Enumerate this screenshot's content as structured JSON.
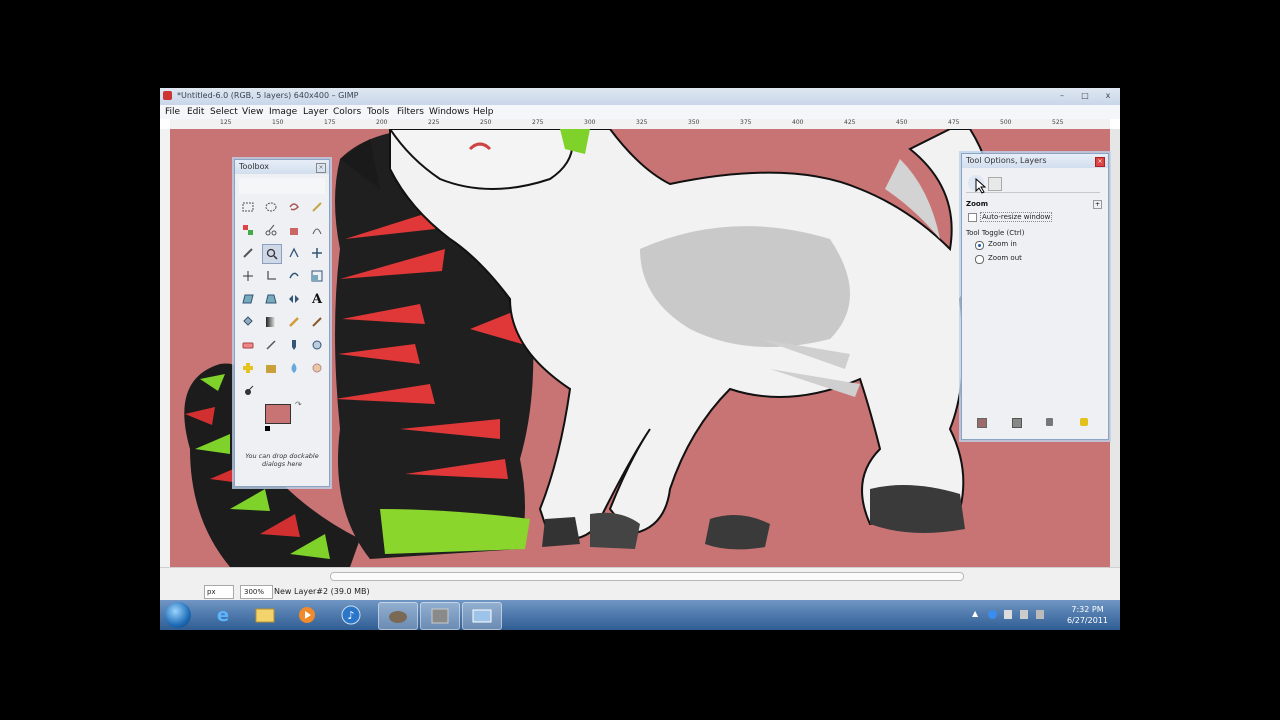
{
  "window": {
    "title": "*Untitled-6.0 (RGB, 5 layers) 640x400 – GIMP",
    "minimize": "–",
    "maximize": "□",
    "close": "x"
  },
  "menu": [
    "File",
    "Edit",
    "Select",
    "View",
    "Image",
    "Layer",
    "Colors",
    "Tools",
    "Filters",
    "Windows",
    "Help"
  ],
  "ruler_ticks": [
    "125",
    "150",
    "175",
    "200",
    "225",
    "250",
    "275",
    "300",
    "325",
    "350",
    "375",
    "400",
    "425",
    "450",
    "475",
    "500",
    "525"
  ],
  "toolbox": {
    "title": "Toolbox",
    "hint": "You can drop dockable dialogs here",
    "fg_color": "#c97474",
    "bg_color": "#ffffff"
  },
  "tool_options": {
    "title": "Tool Options, Layers",
    "section": "Zoom",
    "auto_resize_label": "Auto-resize window",
    "toggle_label": "Tool Toggle  (Ctrl)",
    "zoom_in_label": "Zoom in",
    "zoom_out_label": "Zoom out"
  },
  "status": {
    "unit": "px",
    "zoom": "300%",
    "message": "New Layer#2 (39.0 MB)"
  },
  "taskbar": {
    "time": "7:32 PM",
    "date": "6/27/2011"
  },
  "colors": {
    "canvas_bg": "#c97474",
    "taskbar": "#3d6aa3"
  }
}
